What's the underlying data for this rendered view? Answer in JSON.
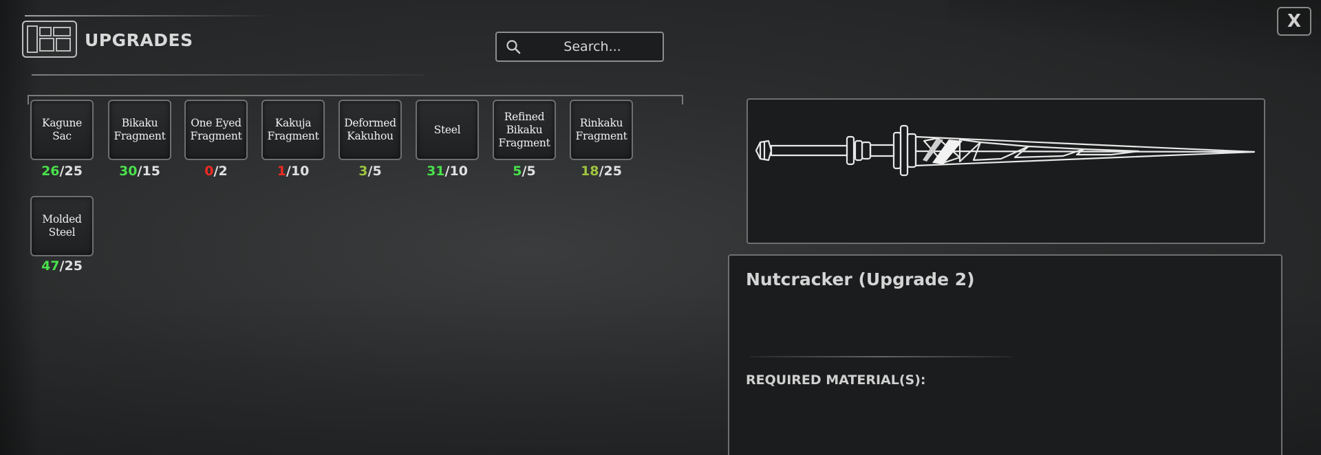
{
  "header": {
    "title": "UPGRADES",
    "icon": "blueprint-icon"
  },
  "search": {
    "placeholder": "Search...",
    "value": ""
  },
  "close": {
    "label": "X"
  },
  "materials": [
    {
      "name": "Kagune Sac",
      "owned": "26",
      "required": "/25",
      "status": "green"
    },
    {
      "name": "Bikaku\nFragment",
      "owned": "30",
      "required": "/15",
      "status": "green"
    },
    {
      "name": "One Eyed\nFragment",
      "owned": "0",
      "required": "/2",
      "status": "red"
    },
    {
      "name": "Kakuja\nFragment",
      "owned": "1",
      "required": "/10",
      "status": "red"
    },
    {
      "name": "Deformed\nKakuhou",
      "owned": "3",
      "required": "/5",
      "status": "olive"
    },
    {
      "name": "Steel",
      "owned": "31",
      "required": "/10",
      "status": "green"
    },
    {
      "name": "Refined\nBikaku\nFragment",
      "owned": "5",
      "required": "/5",
      "status": "green"
    },
    {
      "name": "Rinkaku\nFragment",
      "owned": "18",
      "required": "/25",
      "status": "olive"
    },
    {
      "name": "Molded Steel",
      "owned": "47",
      "required": "/25",
      "status": "green"
    }
  ],
  "detail": {
    "weapon_name": "Nutcracker (Upgrade 2)",
    "required_label": "REQUIRED MATERIAL(S):",
    "preview_icon": "spear-weapon-icon"
  },
  "colors": {
    "green": "#49e04c",
    "red": "#ef2a22",
    "olive": "#9fc53e"
  }
}
